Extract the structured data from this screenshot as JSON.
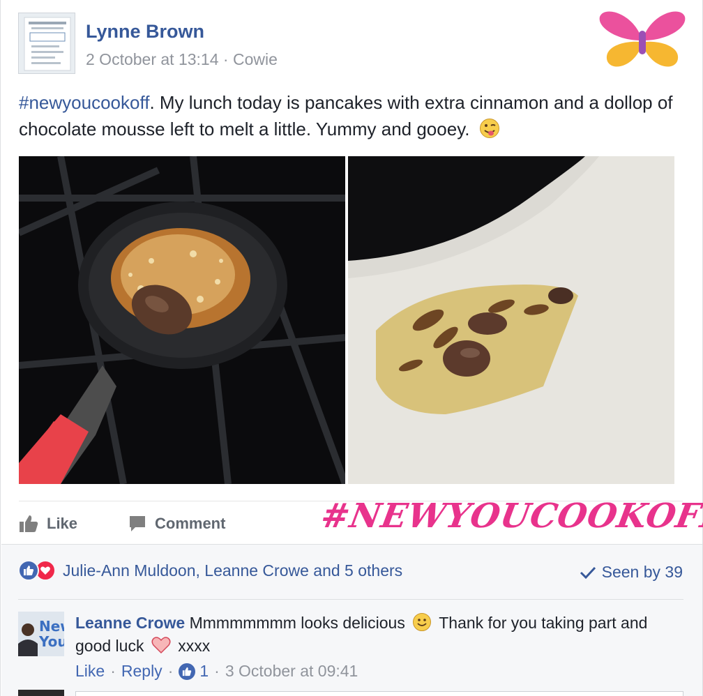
{
  "post": {
    "author": "Lynne Brown",
    "date": "2 October at 13:14",
    "separator": "·",
    "location": "Cowie",
    "hashtag": "#newyoucookoff",
    "text": ". My lunch today is pancakes with extra cinnamon and a dollop of chocolate mousse left to melt a little. Yummy and gooey.",
    "text_emoji": "winking-tongue-emoji"
  },
  "actions": {
    "like_label": "Like",
    "comment_label": "Comment"
  },
  "brand": {
    "tag": "#NEWYOUCOOKOFF",
    "color": "#e8338c"
  },
  "reactions": {
    "summary": "Julie-Ann Muldoon, Leanne Crowe and 5 others",
    "seen": "Seen by 39"
  },
  "comment": {
    "author": "Leanne Crowe",
    "text_part1": "Mmmmmmmm looks delicious",
    "text_part2": "Thank for you taking part and good luck",
    "text_part3": "xxxx",
    "like_action": "Like",
    "reply_action": "Reply",
    "like_count": "1",
    "date": "3 October at 09:41"
  },
  "colors": {
    "link_blue": "#365899",
    "fb_blue": "#4267b2",
    "love_red": "#f0284a",
    "muted": "#90949c"
  }
}
